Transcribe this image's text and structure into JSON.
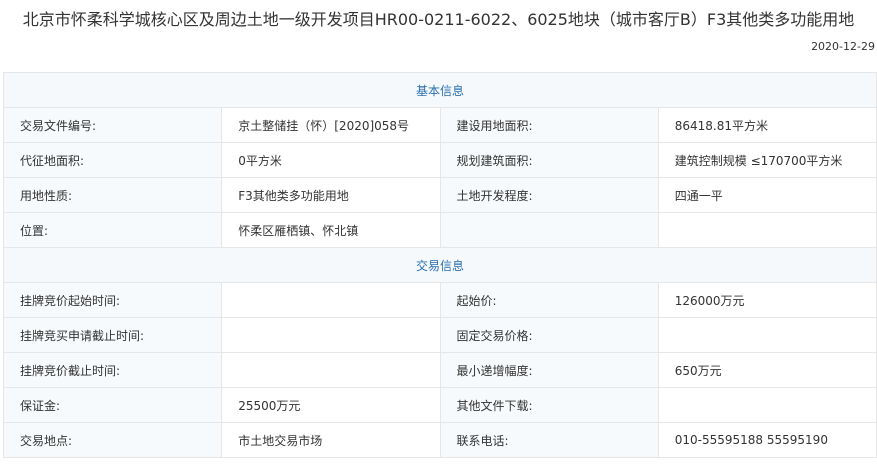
{
  "page": {
    "title": "北京市怀柔科学城核心区及周边土地一级开发项目HR00-0211-6022、6025地块（城市客厅B）F3其他类多功能用地",
    "date": "2020-12-29"
  },
  "basic": {
    "heading": "基本信息",
    "rows": [
      {
        "l1": "交易文件编号:",
        "v1": "京土整储挂（怀）[2020]058号",
        "l2": "建设用地面积:",
        "v2": "86418.81平方米"
      },
      {
        "l1": "代征地面积:",
        "v1": "0平方米",
        "l2": "规划建筑面积:",
        "v2": "建筑控制规模 ≤170700平方米"
      },
      {
        "l1": "用地性质:",
        "v1": "F3其他类多功能用地",
        "l2": "土地开发程度:",
        "v2": "四通一平"
      },
      {
        "l1": "位置:",
        "v1": "怀柔区雁栖镇、怀北镇",
        "l2": "",
        "v2": ""
      }
    ]
  },
  "trade": {
    "heading": "交易信息",
    "rows": [
      {
        "l1": "挂牌竞价起始时间:",
        "v1": "",
        "l2": "起始价:",
        "v2": "126000万元"
      },
      {
        "l1": "挂牌竞买申请截止时间:",
        "v1": "",
        "l2": "固定交易价格:",
        "v2": ""
      },
      {
        "l1": "挂牌竞价截止时间:",
        "v1": "",
        "l2": "最小递增幅度:",
        "v2": "650万元"
      },
      {
        "l1": "保证金:",
        "v1": "25500万元",
        "l2": "其他文件下载:",
        "v2": ""
      },
      {
        "l1": "交易地点:",
        "v1": "市土地交易市场",
        "l2": "联系电话:",
        "v2": "010-55595188 55595190"
      }
    ]
  }
}
